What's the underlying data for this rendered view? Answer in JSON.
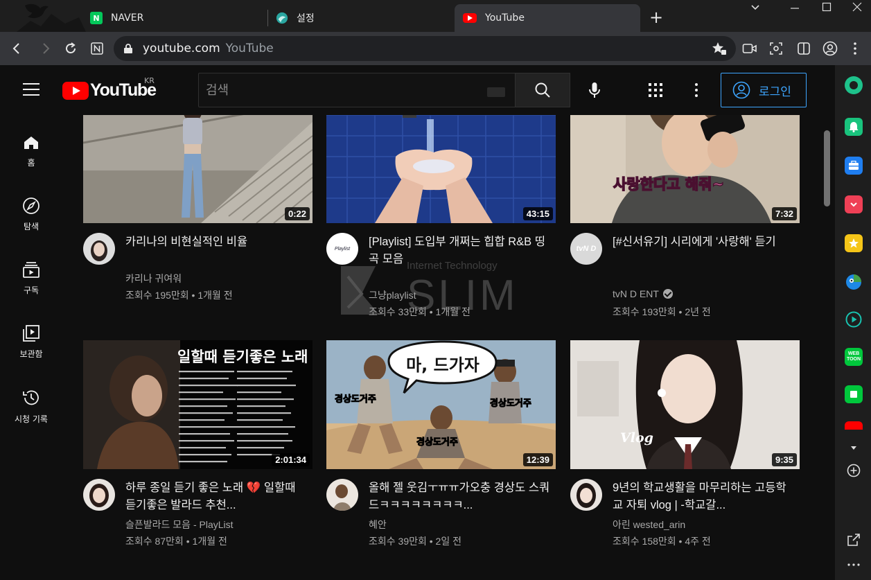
{
  "browser": {
    "tabs": [
      {
        "label": "NAVER",
        "active": false
      },
      {
        "label": "설정",
        "active": false
      },
      {
        "label": "YouTube",
        "active": true
      }
    ],
    "url_host": "youtube.com",
    "url_page_title": "YouTube"
  },
  "header": {
    "logo_text": "YouTube",
    "country_code": "KR",
    "search_placeholder": "검색",
    "login_label": "로그인"
  },
  "sidenav": {
    "items": [
      {
        "label": "홈",
        "icon": "home-icon"
      },
      {
        "label": "탐색",
        "icon": "compass-icon"
      },
      {
        "label": "구독",
        "icon": "subscriptions-icon"
      },
      {
        "label": "보관함",
        "icon": "library-icon"
      },
      {
        "label": "시청 기록",
        "icon": "history-icon"
      }
    ]
  },
  "videos": [
    {
      "title": "카리나의 비현실적인 비율",
      "channel": "카리나 귀여워",
      "meta": "조회수 195만회 • 1개월 전",
      "duration": "0:22",
      "verified": false
    },
    {
      "title": "[Playlist] 도입부 개쩌는 힙합 R&B 띵곡 모음",
      "channel": "그냥playlist",
      "meta": "조회수 33만회 • 1개월 전",
      "duration": "43:15",
      "verified": false,
      "avatar_text": "Playlist"
    },
    {
      "title": "[#신서유기] 시리에게 '사랑해' 듣기",
      "channel": "tvN D ENT",
      "meta": "조회수 193만회 • 2년 전",
      "duration": "7:32",
      "verified": true,
      "avatar_text": "tvN D",
      "thumb_caption": "사랑한다고 해줘~"
    },
    {
      "title": "하루 종일 듣기 좋은 노래 💔 일할때 듣기좋은 발라드 추천...",
      "channel": "슬픈발라드 모음 - PlayList",
      "meta": "조회수 87만회 • 1개월 전",
      "duration": "2:01:34",
      "verified": false,
      "thumb_caption": "일할때 듣기좋은 노래"
    },
    {
      "title": "올해 젤 웃김ㅜㅠㅠ가오충 경상도 스쿼드ㅋㅋㅋㅋㅋㅋㅋㅋ...",
      "channel": "혜안",
      "meta": "조회수 39만회 • 2일 전",
      "duration": "12:39",
      "verified": false,
      "thumb_caption": "마, 드가자",
      "thumb_sub": "경상도거주"
    },
    {
      "title": "9년의 학교생활을 마무리하는 고등학교 자퇴 vlog | -학교갈...",
      "channel": "아린 wested_arin",
      "meta": "조회수 158만회 • 4주 전",
      "duration": "9:35",
      "verified": false,
      "thumb_caption": "Vlog"
    }
  ],
  "watermark": {
    "top": "Internet Technology",
    "main": "SLIM"
  },
  "colors": {
    "accent": "#3ea6ff",
    "brand": "#ff0000",
    "background": "#0f0f0f"
  }
}
